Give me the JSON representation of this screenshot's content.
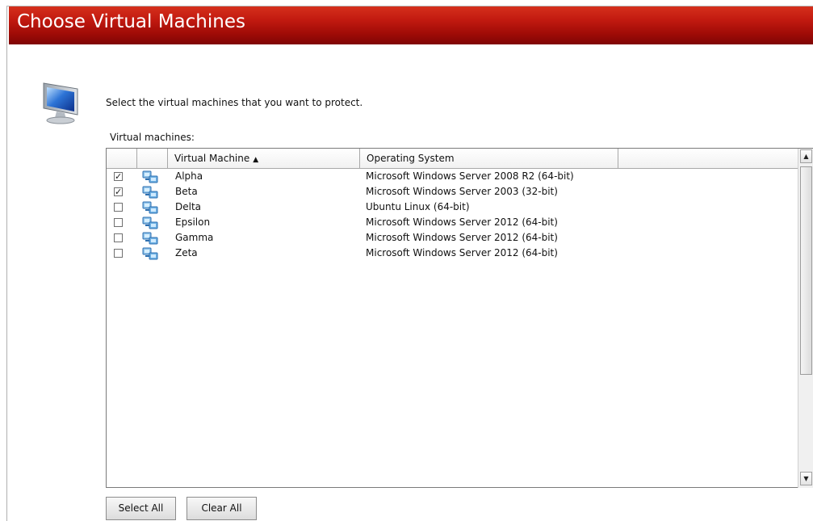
{
  "header": {
    "title": "Choose Virtual Machines"
  },
  "icons": {
    "page_icon": "monitor-icon",
    "vm_icon": "virtual-machine-icon"
  },
  "colors": {
    "header_top": "#d5301c",
    "header_bottom": "#7f0504"
  },
  "instruction": "Select the virtual machines that you want to protect.",
  "list_label": "Virtual machines:",
  "table": {
    "columns": [
      "",
      "",
      "Virtual Machine",
      "Operating System",
      ""
    ],
    "sort_column": "Virtual Machine",
    "sort_indicator": "▲",
    "rows": [
      {
        "checked": true,
        "name": "Alpha",
        "os": "Microsoft Windows Server 2008 R2 (64-bit)"
      },
      {
        "checked": true,
        "name": "Beta",
        "os": "Microsoft Windows Server 2003 (32-bit)"
      },
      {
        "checked": false,
        "name": "Delta",
        "os": "Ubuntu Linux (64-bit)"
      },
      {
        "checked": false,
        "name": "Epsilon",
        "os": "Microsoft Windows Server 2012 (64-bit)"
      },
      {
        "checked": false,
        "name": "Gamma",
        "os": "Microsoft Windows Server 2012 (64-bit)"
      },
      {
        "checked": false,
        "name": "Zeta",
        "os": "Microsoft Windows Server 2012 (64-bit)"
      }
    ]
  },
  "scrollbar": {
    "up_glyph": "▲",
    "down_glyph": "▼"
  },
  "buttons": {
    "select_all": "Select All",
    "clear_all": "Clear All"
  }
}
